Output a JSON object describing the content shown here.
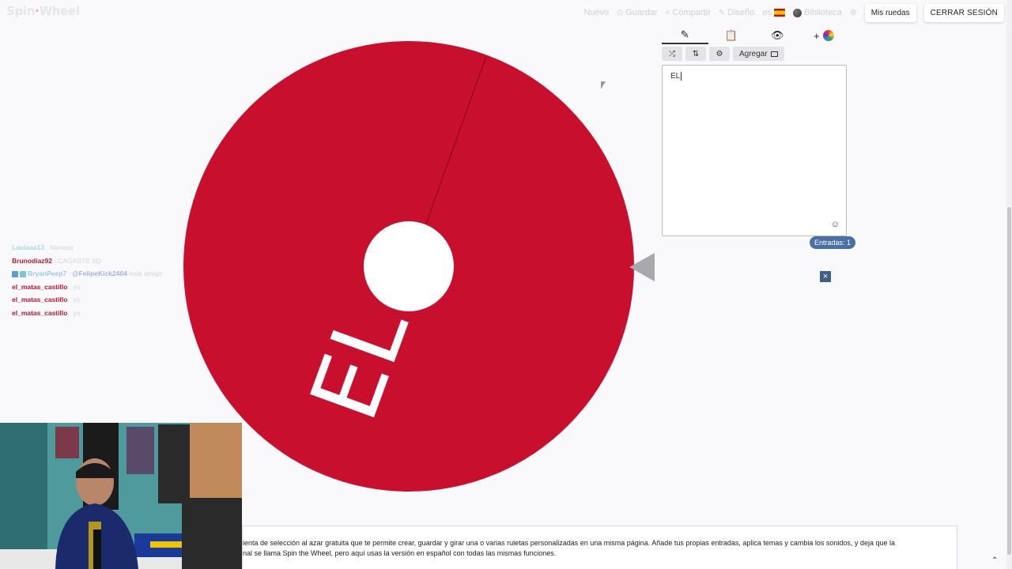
{
  "app": {
    "logo": "Spin",
    "logo_second": "Wheel"
  },
  "topnav": {
    "nuevo": "Nuevo",
    "guardar": "Guardar",
    "compartir": "Compartir",
    "diseno": "Diseño",
    "lang": "es",
    "biblioteca": "Biblioteca",
    "mis_ruedas": "Mis ruedas",
    "cerrar_sesion": "CERRAR SESIÓN"
  },
  "wheel": {
    "color": "#c8102e",
    "segment_label": "EL"
  },
  "panel": {
    "tabs": [
      {
        "icon": "pencil-icon",
        "glyph": "✎"
      },
      {
        "icon": "clipboard-icon",
        "glyph": "📋"
      },
      {
        "icon": "eye-slash-icon",
        "glyph": "👁"
      },
      {
        "icon": "add-color-icon",
        "glyph": "+"
      }
    ],
    "toolbar": {
      "shuffle_glyph": "⤮",
      "sort_glyph": "⇅",
      "settings_glyph": "⚙",
      "agregar_label": "Agregar"
    },
    "entries_text": "EL",
    "emoji_glyph": "☺",
    "entries_count": "Entradas: 1",
    "close_glyph": "×"
  },
  "chat": [
    {
      "user": "Laulaaa13",
      "sep": " : ",
      "msg": "Nanasa"
    },
    {
      "user": "Brunodiaz92",
      "sep": " : ",
      "msg": "CAGASTE XD"
    },
    {
      "user": "BryanPeep7",
      "sep": " : ",
      "mention": "@FelipeKick2404",
      "msg": " hola amigo"
    },
    {
      "user": "el_matas_castillo",
      "sep": " : ",
      "msg": "yo"
    },
    {
      "user": "el_matas_castillo",
      "sep": " : ",
      "msg": "yo"
    },
    {
      "user": "el_matas_castillo",
      "sep": " : ",
      "msg": "yo"
    }
  ],
  "description": {
    "line1": "ienta de selección al azar gratuita que te permite crear, guardar y girar una o varias ruletas personalizadas en una misma página. Añade tus propias entradas, aplica temas y cambia los sonidos, y deja que la",
    "line2": "nal se llama Spin the Wheel, pero aquí usas la versión en español con todas las mismas funciones."
  }
}
